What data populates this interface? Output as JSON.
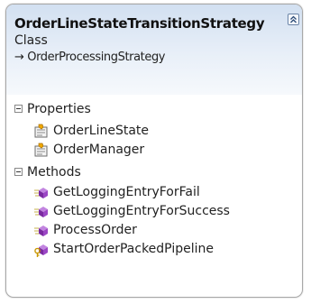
{
  "class_box": {
    "title": "OrderLineStateTransitionStrategy",
    "kind": "Class",
    "base_arrow": "→",
    "base_class": "OrderProcessingStrategy",
    "header_gradient_top": "#d2e0f1",
    "border_color": "#a8a8a8"
  },
  "sections": {
    "properties": {
      "label": "Properties",
      "items": [
        {
          "label": "OrderLineState",
          "icon": "property-icon"
        },
        {
          "label": "OrderManager",
          "icon": "property-icon"
        }
      ]
    },
    "methods": {
      "label": "Methods",
      "items": [
        {
          "label": "GetLoggingEntryForFail",
          "icon": "method-icon"
        },
        {
          "label": "GetLoggingEntryForSuccess",
          "icon": "method-icon"
        },
        {
          "label": "ProcessOrder",
          "icon": "method-icon"
        },
        {
          "label": "StartOrderPackedPipeline",
          "icon": "private-method-icon"
        }
      ]
    }
  },
  "icon_colors": {
    "method": "#8e44ad",
    "property_hand": "#f0a800"
  }
}
